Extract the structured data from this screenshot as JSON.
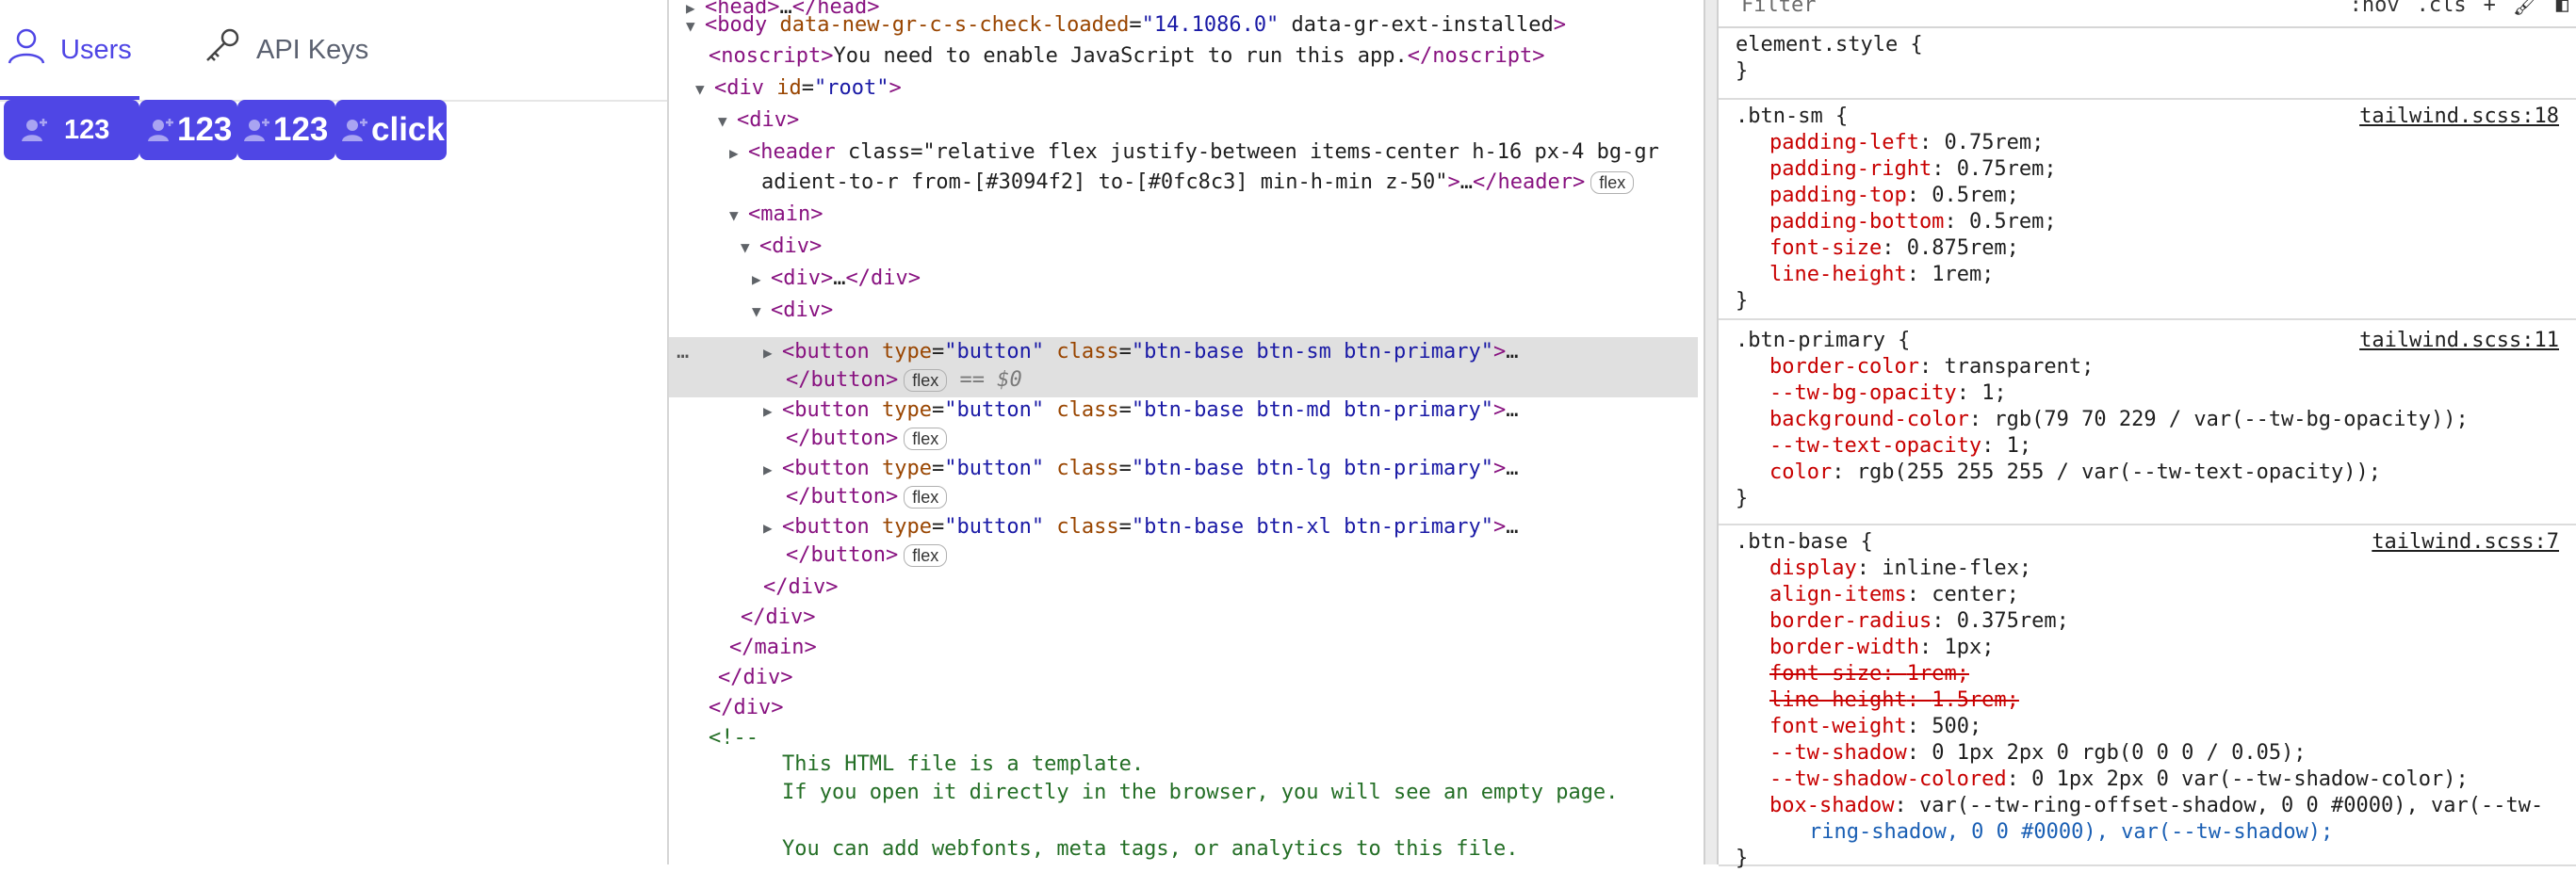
{
  "app": {
    "tabs": [
      {
        "label": "Users",
        "icon": "user-icon",
        "active": true
      },
      {
        "label": "API Keys",
        "icon": "key-icon",
        "active": false
      }
    ],
    "buttons": [
      "123",
      "123",
      "123",
      "click"
    ],
    "accent": "#4f46e5"
  },
  "elements": {
    "lines": [
      {
        "text": "<head>…</head>"
      },
      {
        "text": "<body data-new-gr-c-s-check-loaded=\"14.1086.0\" data-gr-ext-installed>"
      },
      {
        "text": "<noscript>You need to enable JavaScript to run this app.</noscript>"
      },
      {
        "text": "<div id=\"root\">"
      },
      {
        "text": "<div>"
      },
      {
        "text": "<header class=\"relative flex justify-between items-center h-16 px-4 bg-gr"
      },
      {
        "text": "adient-to-r from-[#3094f2] to-[#0fc8c3] min-h-min z-50\">…</header>"
      },
      {
        "text": "<main>"
      },
      {
        "text": "<div>"
      },
      {
        "text": "<div>…</div>"
      },
      {
        "text": "<div>"
      },
      {
        "text": "<button type=\"button\" class=\"btn-base btn-sm btn-primary\">…"
      },
      {
        "text": "</button>"
      },
      {
        "text": "<button type=\"button\" class=\"btn-base btn-md btn-primary\">…"
      },
      {
        "text": "</button>"
      },
      {
        "text": "<button type=\"button\" class=\"btn-base btn-lg btn-primary\">…"
      },
      {
        "text": "</button>"
      },
      {
        "text": "<button type=\"button\" class=\"btn-base btn-xl btn-primary\">…"
      },
      {
        "text": "</button>"
      },
      {
        "text": "</div>"
      },
      {
        "text": "</div>"
      },
      {
        "text": "</main>"
      },
      {
        "text": "</div>"
      },
      {
        "text": "</div>"
      },
      {
        "text": "<!--"
      },
      {
        "text": "This HTML file is a template."
      },
      {
        "text": "If you open it directly in the browser, you will see an empty page."
      },
      {
        "text": ""
      },
      {
        "text": "You can add webfonts, meta tags, or analytics to this file."
      }
    ],
    "badge_flex": "flex",
    "selected_marker": "== $0",
    "dots": "…"
  },
  "styles": {
    "filter_placeholder": "Filter",
    "tools": [
      ":hov",
      ".cls",
      "+"
    ],
    "rules": [
      {
        "selector": "element.style {",
        "close": "}",
        "source": "",
        "props": []
      },
      {
        "selector": ".btn-sm {",
        "close": "}",
        "source": "tailwind.scss:18",
        "props": [
          {
            "name": "padding-left",
            "value": "0.75rem;"
          },
          {
            "name": "padding-right",
            "value": "0.75rem;"
          },
          {
            "name": "padding-top",
            "value": "0.5rem;"
          },
          {
            "name": "padding-bottom",
            "value": "0.5rem;"
          },
          {
            "name": "font-size",
            "value": "0.875rem;"
          },
          {
            "name": "line-height",
            "value": "1rem;"
          }
        ]
      },
      {
        "selector": ".btn-primary {",
        "close": "}",
        "source": "tailwind.scss:11",
        "props": [
          {
            "name": "border-color",
            "value": "transparent;"
          },
          {
            "name": "--tw-bg-opacity",
            "value": "1;"
          },
          {
            "name": "background-color",
            "value": "rgb(79 70 229 / var(--tw-bg-opacity));"
          },
          {
            "name": "--tw-text-opacity",
            "value": "1;"
          },
          {
            "name": "color",
            "value": "rgb(255 255 255 / var(--tw-text-opacity));"
          }
        ]
      },
      {
        "selector": ".btn-base {",
        "close": "}",
        "source": "tailwind.scss:7",
        "props": [
          {
            "name": "display",
            "value": "inline-flex;"
          },
          {
            "name": "align-items",
            "value": "center;"
          },
          {
            "name": "border-radius",
            "value": "0.375rem;"
          },
          {
            "name": "border-width",
            "value": "1px;"
          },
          {
            "name": "font-size",
            "value": "1rem;",
            "struck": true
          },
          {
            "name": "line-height",
            "value": "1.5rem;",
            "struck": true
          },
          {
            "name": "font-weight",
            "value": "500;"
          },
          {
            "name": "--tw-shadow",
            "value": "0 1px 2px 0 rgb(0 0 0 / 0.05);"
          },
          {
            "name": "--tw-shadow-colored",
            "value": "0 1px 2px 0 var(--tw-shadow-color);"
          },
          {
            "name": "box-shadow",
            "value": "var(--tw-ring-offset-shadow, 0 0 #0000), var(--tw-"
          },
          {
            "name": "",
            "value": "ring-shadow, 0 0 #0000), var(--tw-shadow);"
          }
        ]
      }
    ]
  }
}
